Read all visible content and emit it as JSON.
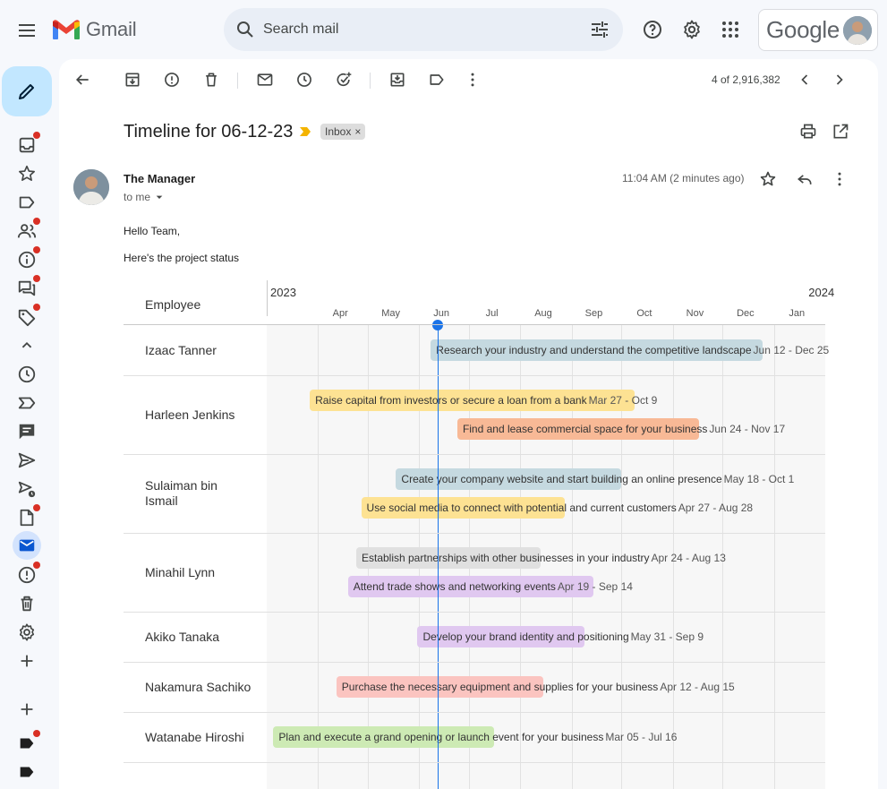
{
  "app": {
    "product_name": "Gmail",
    "search_placeholder": "Search mail",
    "google_label": "Google"
  },
  "toolbar": {
    "count_text": "4 of 2,916,382"
  },
  "email": {
    "subject": "Timeline for 06-12-23",
    "label_chip": "Inbox",
    "label_chip_close": "×",
    "sender": "The Manager",
    "recipient": "to me",
    "time": "11:04 AM (2 minutes ago)",
    "body_lines": [
      "Hello Team,",
      "Here's the project status"
    ]
  },
  "colors": {
    "accent": "#1a73e8",
    "compose_bg": "#c2e7ff",
    "notification_dot": "#d93025",
    "important_marker": "#f4b400"
  },
  "chart_data": {
    "type": "timeline",
    "row_header": "Employee",
    "years": [
      {
        "label": "2023",
        "month_index": 0
      },
      {
        "label": "2024",
        "month_index": 10
      }
    ],
    "months": [
      "Apr",
      "May",
      "Jun",
      "Jul",
      "Aug",
      "Sep",
      "Oct",
      "Nov",
      "Dec",
      "Jan"
    ],
    "axis_range": [
      "2023-03-01",
      "2024-02-01"
    ],
    "today": "2023-06-12",
    "rows": [
      {
        "name": "Izaac Tanner",
        "tasks": [
          {
            "title": "Research your industry and understand the competitive landscape",
            "dates": "Jun 12 - Dec 25",
            "start": "2023-06-08",
            "end": "2023-12-25",
            "color": "#c5d9e0"
          }
        ]
      },
      {
        "name": "Harleen Jenkins",
        "tasks": [
          {
            "title": "Raise capital from investors or secure a loan from a bank",
            "dates": "Mar 27 - Oct 9",
            "start": "2023-03-27",
            "end": "2023-10-09",
            "color": "#fde293"
          },
          {
            "title": "Find and lease commercial space for your business",
            "dates": "Jun 24 - Nov 17",
            "start": "2023-06-24",
            "end": "2023-11-17",
            "color": "#f8b996"
          }
        ]
      },
      {
        "name": "Sulaiman bin Ismail",
        "tasks": [
          {
            "title": "Create your company website and start building an online presence",
            "dates": "May 18 - Oct 1",
            "start": "2023-05-18",
            "end": "2023-10-01",
            "color": "#c5d9e0"
          },
          {
            "title": "Use social media to connect with potential and current customers",
            "dates": "Apr 27 - Aug 28",
            "start": "2023-04-27",
            "end": "2023-08-28",
            "color": "#fde293"
          }
        ]
      },
      {
        "name": "Minahil Lynn",
        "tasks": [
          {
            "title": "Establish partnerships with other businesses in your industry",
            "dates": "Apr 24 - Aug 13",
            "start": "2023-04-24",
            "end": "2023-08-13",
            "color": "#e0e0e0"
          },
          {
            "title": "Attend trade shows and networking events",
            "dates": "Apr 19 - Sep 14",
            "start": "2023-04-19",
            "end": "2023-09-14",
            "color": "#e0c8f0"
          }
        ]
      },
      {
        "name": "Akiko Tanaka",
        "tasks": [
          {
            "title": "Develop your brand identity and positioning",
            "dates": "May 31 - Sep 9",
            "start": "2023-05-31",
            "end": "2023-09-09",
            "color": "#e0c8f0"
          }
        ]
      },
      {
        "name": "Nakamura Sachiko",
        "tasks": [
          {
            "title": "Purchase the necessary equipment and supplies for your business",
            "dates": "Apr 12 - Aug 15",
            "start": "2023-04-12",
            "end": "2023-08-15",
            "color": "#fbc4c0"
          }
        ]
      },
      {
        "name": "Watanabe Hiroshi",
        "tasks": [
          {
            "title": "Plan and execute a grand opening or launch event for your business",
            "dates": "Mar 05 - Jul 16",
            "start": "2023-03-05",
            "end": "2023-07-16",
            "color": "#cdeab4"
          }
        ]
      }
    ]
  }
}
